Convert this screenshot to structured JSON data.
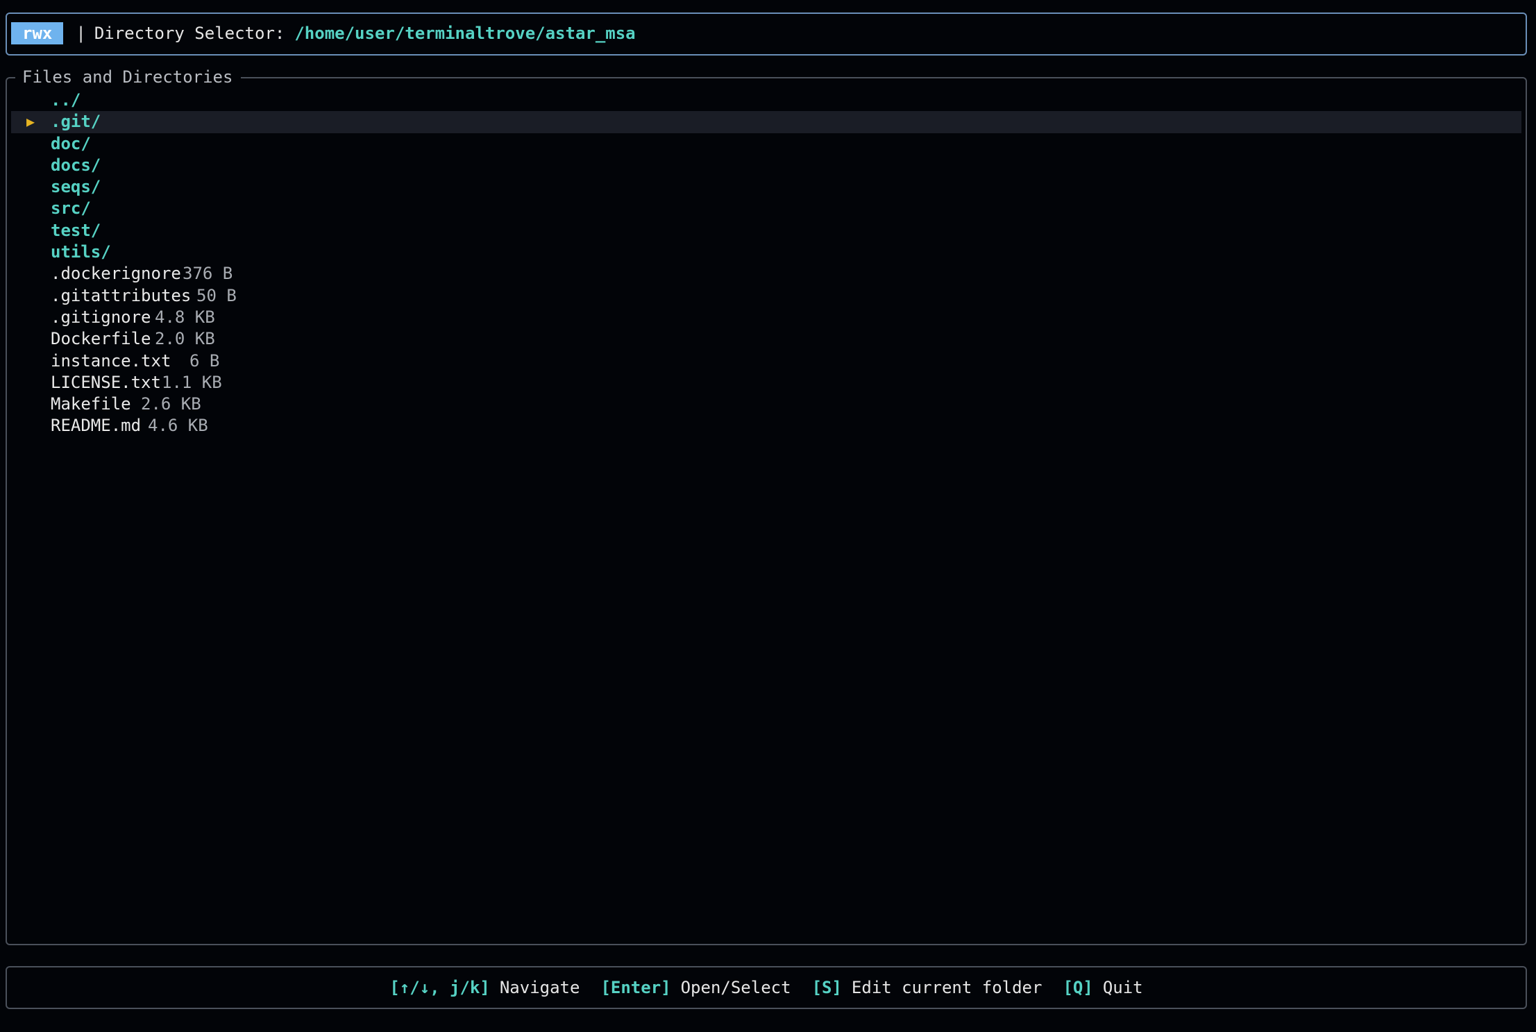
{
  "header": {
    "badge": "rwx",
    "separator": "|",
    "label": "Directory Selector:",
    "path": "/home/user/terminaltrove/astar_msa"
  },
  "panel": {
    "title": "Files and Directories",
    "selected_index": 1,
    "entries": [
      {
        "name": "../",
        "type": "dir",
        "size": ""
      },
      {
        "name": ".git/",
        "type": "dir",
        "size": ""
      },
      {
        "name": "doc/",
        "type": "dir",
        "size": ""
      },
      {
        "name": "docs/",
        "type": "dir",
        "size": ""
      },
      {
        "name": "seqs/",
        "type": "dir",
        "size": ""
      },
      {
        "name": "src/",
        "type": "dir",
        "size": ""
      },
      {
        "name": "test/",
        "type": "dir",
        "size": ""
      },
      {
        "name": "utils/",
        "type": "dir",
        "size": ""
      },
      {
        "name": ".dockerignore",
        "type": "file",
        "size": "376 B"
      },
      {
        "name": ".gitattributes",
        "type": "file",
        "size": "50 B"
      },
      {
        "name": ".gitignore",
        "type": "file",
        "size": "4.8 KB"
      },
      {
        "name": "Dockerfile",
        "type": "file",
        "size": "2.0 KB"
      },
      {
        "name": "instance.txt",
        "type": "file",
        "size": "6 B"
      },
      {
        "name": "LICENSE.txt",
        "type": "file",
        "size": "1.1 KB"
      },
      {
        "name": "Makefile",
        "type": "file",
        "size": "2.6 KB"
      },
      {
        "name": "README.md",
        "type": "file",
        "size": "4.6 KB"
      }
    ],
    "cursor_icon": "play-triangle-icon"
  },
  "footer": {
    "hints": [
      {
        "key": "[↑/↓, j/k]",
        "desc": "Navigate"
      },
      {
        "key": "[Enter]",
        "desc": "Open/Select"
      },
      {
        "key": "[S]",
        "desc": "Edit current folder"
      },
      {
        "key": "[Q]",
        "desc": "Quit"
      }
    ]
  },
  "colors": {
    "background": "#020408",
    "accent": "#56d2c4",
    "badge": "#6fb3ee",
    "cursor": "#e6b422",
    "selection": "#1a1d26"
  }
}
